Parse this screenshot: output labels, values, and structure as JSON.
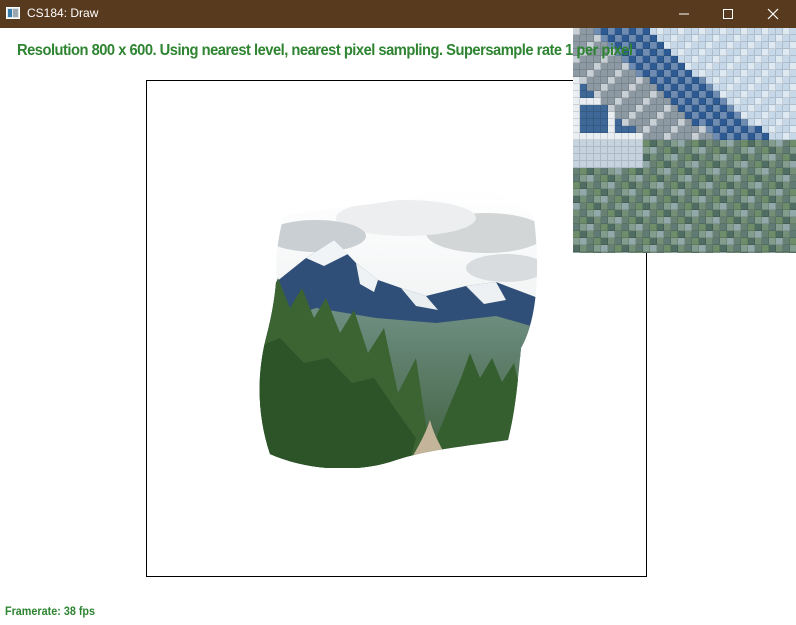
{
  "window": {
    "title": "CS184: Draw",
    "icon": "app-window-icon",
    "controls": [
      "minimize-icon",
      "maximize-icon",
      "close-icon"
    ],
    "titlebar_color": "#583a1f"
  },
  "overlay": {
    "status_text": "Resolution 800 x 600. Using nearest level, nearest pixel sampling. Supersample rate 1 per pixel",
    "framerate_text": "Framerate: 38 fps",
    "text_color": "#2e8431"
  },
  "scene": {
    "image_subject": "warped landscape texture: snowy mountains, cloudy sky, pine forest, valley road",
    "zoom_view": "pixel inspector magnifier grid"
  }
}
